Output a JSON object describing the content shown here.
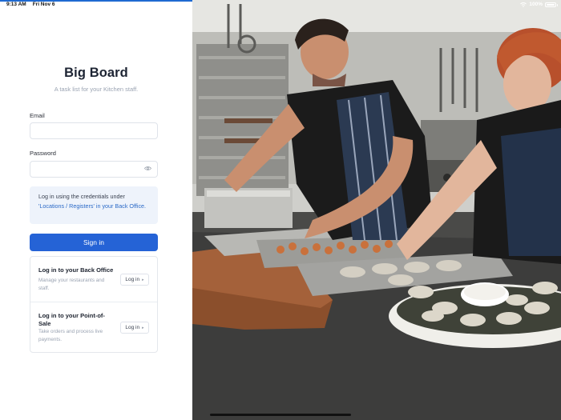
{
  "status_bar": {
    "time": "9:13 AM",
    "date": "Fri Nov 6",
    "battery": "100%",
    "wifi_icon": "wifi-icon",
    "battery_icon": "battery-icon"
  },
  "brand": {
    "title": "Big Board",
    "subtitle": "A task list for your Kitchen staff."
  },
  "form": {
    "email_label": "Email",
    "email_value": "",
    "email_placeholder": "",
    "password_label": "Password",
    "password_value": "",
    "password_placeholder": "",
    "password_icon": "eye-icon"
  },
  "info": {
    "prefix": "Log in using the credentials under ",
    "link": "'Locations / Registers' in your Back Office."
  },
  "signin_label": "Sign in",
  "options": [
    {
      "title": "Log in to your Back Office",
      "description": "Manage your restaurants and staff.",
      "button": "Log in"
    },
    {
      "title": "Log in to your Point-of-Sale",
      "description": "Take orders and process live payments.",
      "button": "Log in"
    }
  ],
  "colors": {
    "accent": "#2563d6",
    "info_bg": "#eef3fb",
    "link": "#2a69c7"
  }
}
